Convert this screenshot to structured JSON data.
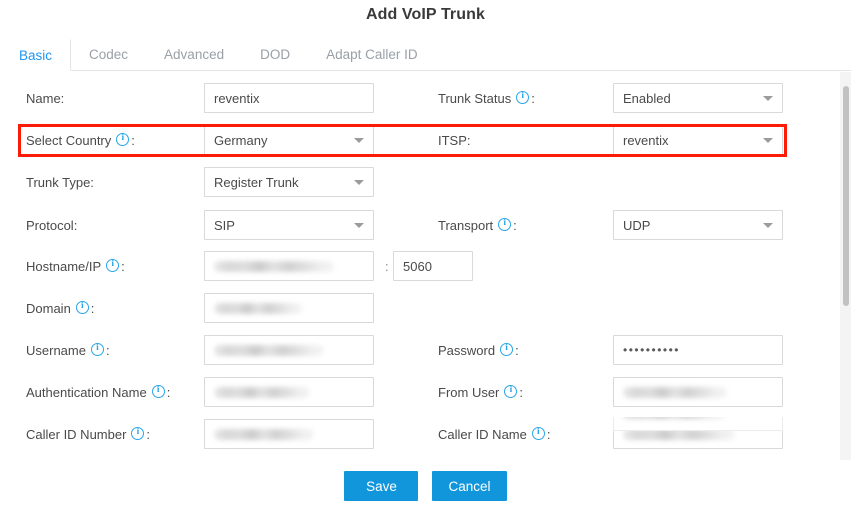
{
  "dialog": {
    "title": "Add VoIP Trunk"
  },
  "tabs": [
    {
      "label": "Basic",
      "active": true
    },
    {
      "label": "Codec",
      "active": false
    },
    {
      "label": "Advanced",
      "active": false
    },
    {
      "label": "DOD",
      "active": false
    },
    {
      "label": "Adapt Caller ID",
      "active": false
    }
  ],
  "fields": {
    "name": {
      "label": "Name:",
      "value": "reventix",
      "type": "text"
    },
    "trunk_status": {
      "label": "Trunk Status",
      "value": "Enabled",
      "type": "select",
      "has_info": true
    },
    "select_country": {
      "label": "Select Country",
      "value": "Germany",
      "type": "select",
      "has_info": true
    },
    "itsp": {
      "label": "ITSP:",
      "value": "reventix",
      "type": "select"
    },
    "trunk_type": {
      "label": "Trunk Type:",
      "value": "Register Trunk",
      "type": "select"
    },
    "protocol": {
      "label": "Protocol:",
      "value": "SIP",
      "type": "select"
    },
    "transport": {
      "label": "Transport",
      "value": "UDP",
      "type": "select",
      "has_info": true
    },
    "hostname_ip": {
      "label": "Hostname/IP",
      "value": "",
      "type": "text",
      "has_info": true,
      "redacted": true
    },
    "port": {
      "label": "",
      "value": "5060",
      "type": "text"
    },
    "port_separator": ":",
    "domain": {
      "label": "Domain",
      "value": "",
      "type": "text",
      "has_info": true,
      "redacted": true
    },
    "username": {
      "label": "Username",
      "value": "",
      "type": "text",
      "has_info": true,
      "redacted": true
    },
    "password": {
      "label": "Password",
      "value": "••••••••••",
      "type": "password",
      "has_info": true
    },
    "authentication_name": {
      "label": "Authentication Name",
      "value": "",
      "type": "text",
      "has_info": true,
      "redacted": true
    },
    "from_user": {
      "label": "From User",
      "value": "",
      "type": "text",
      "has_info": true,
      "redacted": true
    },
    "caller_id_number": {
      "label": "Caller ID Number",
      "value": "",
      "type": "text",
      "has_info": true,
      "redacted": true
    },
    "caller_id_name": {
      "label": "Caller ID Name",
      "value": "",
      "type": "text",
      "has_info": true,
      "redacted": true
    }
  },
  "footer": {
    "save_label": "Save",
    "cancel_label": "Cancel"
  },
  "annotation": {
    "highlight_color": "#fc1b06",
    "highlight_target": "select-country-and-itsp-row"
  },
  "colors": {
    "accent": "#1296db",
    "active_tab": "#2196f3",
    "info_icon": "#29a6e8",
    "label_text": "#4a4a4a",
    "inactive_tab": "#9aa0a6"
  }
}
